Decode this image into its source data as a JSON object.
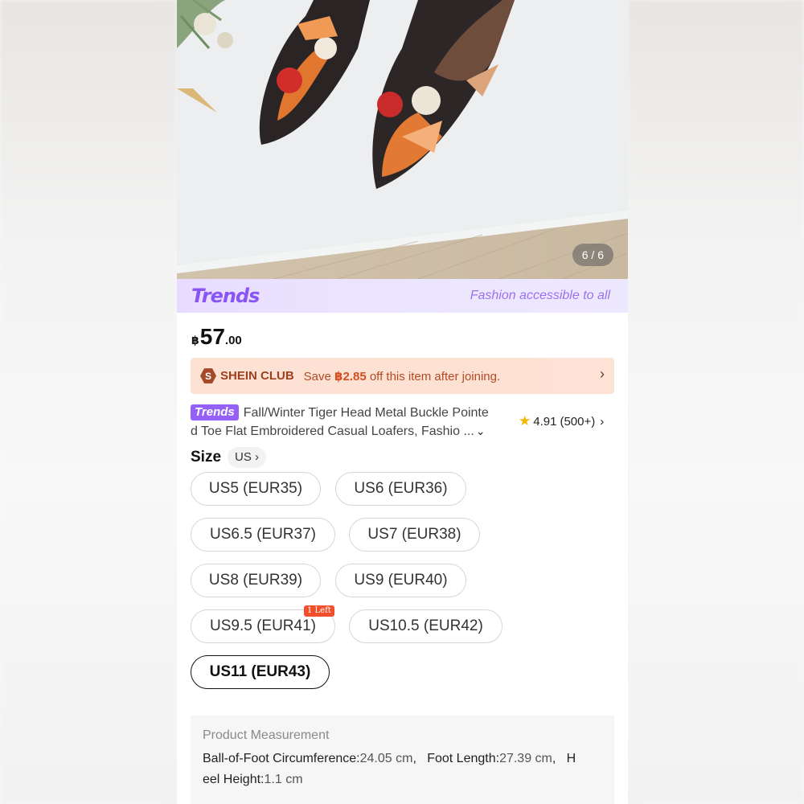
{
  "gallery": {
    "counter": "6 / 6"
  },
  "trends_banner": {
    "logo": "Trends",
    "tagline": "Fashion accessible to all"
  },
  "price": {
    "currency": "฿",
    "integer": "57",
    "decimal": ".00"
  },
  "club": {
    "badge": "S",
    "name": "SHEIN CLUB",
    "text_before": "Save ",
    "amount": "฿2.85",
    "text_after": " off this item after joining.",
    "chevron": "›"
  },
  "product": {
    "badge": "Trends",
    "title_line1": "Fall/Winter Tiger Head Metal Buckle Pointe",
    "title_line2": "d Toe Flat Embroidered Casual Loafers, Fashio ...",
    "expand_icon": "chevron-down-icon",
    "rating": "4.91",
    "review_count": "(500+)",
    "rating_chevron": "›"
  },
  "size": {
    "label": "Size",
    "region": "US",
    "region_chevron": "›",
    "options": [
      "US5 (EUR35)",
      "US6 (EUR36)",
      "US6.5 (EUR37)",
      "US7 (EUR38)",
      "US8 (EUR39)",
      "US9 (EUR40)",
      "US9.5 (EUR41)",
      "US10.5 (EUR42)",
      "US11 (EUR43)"
    ],
    "selected": "US11 (EUR43)",
    "stock_tag": "1 Left"
  },
  "measurement": {
    "title": "Product Measurement",
    "ball_label": "Ball-of-Foot Circumference:",
    "ball_value": "24.05 cm",
    "foot_label": "Foot Length:",
    "foot_value": "27.39 cm",
    "heel_label_a": "H",
    "heel_label_b": "eel Height:",
    "heel_value": "1.1 cm"
  },
  "colors": {
    "accent_purple": "#8a55f5",
    "club_bg": "#fde1d3",
    "stock_tag": "#f1502c"
  }
}
